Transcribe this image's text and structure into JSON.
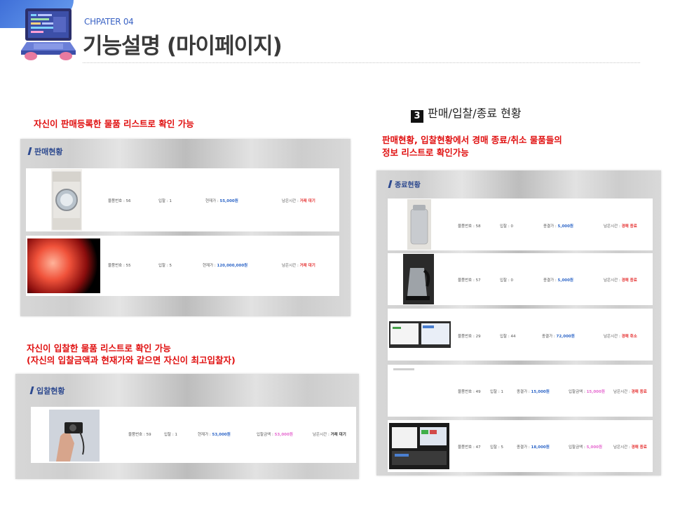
{
  "header": {
    "chapter": "CHPATER 04",
    "title": "기능설명 (마이페이지)"
  },
  "notes": {
    "sales_note": "자신이 판매등록한 물품 리스트로 확인 가능",
    "bid_note_line1": "자신이 입찰한 물품 리스트로 확인 가능",
    "bid_note_line2": "(자신의 입찰금액과 현재가와 같으면 자신이 최고입찰자)",
    "section3_number": "3",
    "section3_title": "판매/입찰/종료 현황",
    "section3_note_line1": "판매현황, 입찰현황에서 경매 종료/취소 물품들의",
    "section3_note_line2": "정보 리스트로 확인가능"
  },
  "sales_panel": {
    "heading": "판매현황",
    "rows": [
      {
        "item_no": "물품번호 : 56",
        "bids": "입찰 : 1",
        "price_label": "현재가 : ",
        "price": "55,000원",
        "time_label": "남은시간 : ",
        "status": "거래 대기",
        "thumb": "washing-machine"
      },
      {
        "item_no": "물품번호 : 55",
        "bids": "입찰 : 5",
        "price_label": "현재가 : ",
        "price": "120,000,000원",
        "time_label": "남은시간 : ",
        "status": "거래 대기",
        "thumb": "red-glow"
      }
    ]
  },
  "bid_panel": {
    "heading": "입찰현황",
    "rows": [
      {
        "item_no": "물품번호 : 59",
        "bids": "입찰 : 1",
        "price_label": "현재가 : ",
        "price": "53,000원",
        "bid_label": "입찰금액 : ",
        "bid_amount": "53,000원",
        "time_label": "남은시간 : ",
        "status": "거래 대기",
        "thumb": "camera-in-hand"
      }
    ]
  },
  "end_panel": {
    "heading": "종료현황",
    "rows": [
      {
        "item_no": "물품번호 : 58",
        "bids": "입찰 : 0",
        "price_label": "종결가 : ",
        "price": "5,000원",
        "time_label": "남은시간 : ",
        "status": "경매 종료",
        "thumb": "humidifier"
      },
      {
        "item_no": "물품번호 : 57",
        "bids": "입찰 : 0",
        "price_label": "종결가 : ",
        "price": "5,000원",
        "time_label": "남은시간 : ",
        "status": "경매 종료",
        "thumb": "kettle"
      },
      {
        "item_no": "물품번호 : 29",
        "bids": "입찰 : 44",
        "price_label": "종결가 : ",
        "price": "72,000원",
        "time_label": "남은시간 : ",
        "status": "경매 취소",
        "thumb": "screenshot"
      },
      {
        "item_no": "물품번호 : 49",
        "bids": "입찰 : 1",
        "price_label": "종결가 : ",
        "price": "15,000원",
        "bid_label": "입찰금액 : ",
        "bid_amount": "15,000원",
        "time_label": "남은시간 : ",
        "status": "경매 종료",
        "thumb": "blank"
      },
      {
        "item_no": "물품번호 : 47",
        "bids": "입찰 : 5",
        "price_label": "종결가 : ",
        "price": "18,000원",
        "bid_label": "입찰금액 : ",
        "bid_amount": "5,000원",
        "time_label": "남은시간 : ",
        "status": "경매 종료",
        "thumb": "screenshot-dark"
      }
    ]
  },
  "colors": {
    "accent_blue": "#2f67c8",
    "status_red": "#e53030",
    "note_red": "#e01010",
    "bid_pink": "#e66ad0"
  }
}
